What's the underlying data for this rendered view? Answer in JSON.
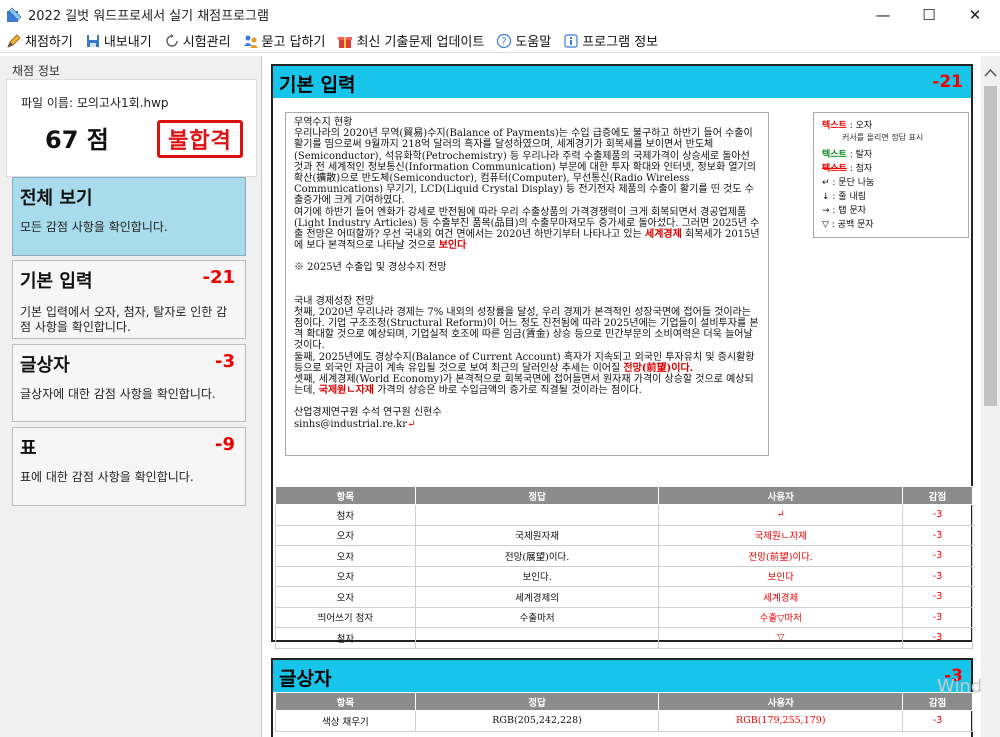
{
  "window": {
    "title": "2022 길벗 워드프로세서 실기 채점프로그램",
    "minimize": "—",
    "maximize": "☐",
    "close": "✕"
  },
  "toolbar": {
    "items": [
      {
        "label": "채점하기",
        "icon": "pencil-icon"
      },
      {
        "label": "내보내기",
        "icon": "save-icon"
      },
      {
        "label": "시험관리",
        "icon": "refresh-icon"
      },
      {
        "label": "묻고 답하기",
        "icon": "people-icon"
      },
      {
        "label": "최신 기출문제 업데이트",
        "icon": "gift-icon"
      },
      {
        "label": "도움말",
        "icon": "help-icon"
      },
      {
        "label": "프로그램 정보",
        "icon": "info-icon"
      }
    ]
  },
  "sidebar": {
    "group_label": "채점 정보",
    "file_label": "파일 이름: 모의고사1회.hwp",
    "score": "67 점",
    "result_stamp": "불합격",
    "cards": [
      {
        "title": "전체 보기",
        "score": "",
        "desc": "모든 감점 사항을 확인합니다."
      },
      {
        "title": "기본 입력",
        "score": "-21",
        "desc": "기본 입력에서 오자, 첨자, 탈자로 인한 감점 사항을 확인합니다."
      },
      {
        "title": "글상자",
        "score": "-3",
        "desc": "글상자에 대한 감점 사항을 확인합니다."
      },
      {
        "title": "표",
        "score": "-9",
        "desc": "표에 대한 감점 사항을 확인합니다."
      }
    ]
  },
  "section1": {
    "title": "기본 입력",
    "score": "-21",
    "doc": {
      "heading": "무역수지 현황",
      "para1": "우리나라의 2020년 무역(貿易)수지(Balance of Payments)는 수입 급증에도 불구하고 하반기 들어 수출이 활기를 띰으로써 9월까지 218억 달러의 흑자를 달성하였으며, 세계경기가 회복세를 보이면서 반도체(Semiconductor), 석유화학(Petrochemistry) 등 우리나라 주력 수출제품의 국제가격이 상승세로 돌아선 것과 전 세계적인 정보통신(Information Communication) 부문에 대한 투자 확대와 인터넷, 정보화 열기의 확산(擴散)으로 반도체(Semiconductor), 컴퓨터(Computer), 무선통신(Radio Wireless Communications) 무기기, LCD(Liquid Crystal Display) 등 전기전자 제품의 수출이 활기를 띤 것도 수출증가에 크게 기여하였다.",
      "para2a": "여기에 하반기 들어 엔화가 강세로 반전됨에 따라 우리 수출상품의 가격경쟁력이 크게 회복되면서 경공업제품(Light Industry Articles) 등 수출부진 품목(品目)의 수출무마져모두 증가세로 돌아섰다. 그러면 2025년 수출 전망은 어떠할까? 우선 국내외 여건 면에서는 2020년 하반기부터 나타나고 있는",
      "para2red1": "세계경제",
      "para2b": "회복세가 2015년에 보다 본격적으로 나타날 것으로",
      "para2red2": "보인다",
      "note": "※ 2025년 수출입 및 경상수지 전망",
      "heading2": "국내 경제성장 전망",
      "para3": "첫째, 2020년 우리나라 경제는 7% 내외의 성장률을 달성, 우리 경제가 본격적인 성장국면에 접어들 것이라는 점이다. 기업 구조조정(Structural Reform)이 어느 정도 진전됨에 따라 2025년에는 기업들이 설비투자를 본격 확대할 것으로 예상되며, 기업실적 호조에 따른 임금(賃金) 상승 등으로 민간부문의 소비여력은 더욱 늘어날 것이다.",
      "para4": "둘째, 2025년에도 경상수지(Balance of Current Account) 흑자가 지속되고 외국인 투자유치 및 증시활황 등으로 외국인 자금이 계속 유입될 것으로 보여 최근의 달러인상 추세는 이어질",
      "para4red": "전망(前望)이다.",
      "para5a": "셋째, 세계경제(World Economy)가 본격적으로 회복국면에 접어들면서 원자재 가격이 상승할 것으로 예상되는데,",
      "para5red": "국제원ㄴ자재",
      "para5b": "가격의 상승은 바로 수입금액의 증가로 직결될 것이라는 점이다.",
      "sign1": "산업경제연구원 수석 연구원 신현수",
      "sign2": "sinhs@industrial.re.kr",
      "enter_mark": "↵"
    },
    "legend": [
      {
        "key": "텍스트",
        "val": ": 오자",
        "color": "#e00",
        "style": "normal"
      },
      {
        "key": "",
        "val": "커서를 올리면 정답 표시",
        "color": "#333",
        "style": "sub"
      },
      {
        "key": "텍스트",
        "val": ": 탈자",
        "color": "#0a8a1a",
        "style": "normal"
      },
      {
        "key": "텍스트",
        "val": ": 첨자",
        "color": "#e00",
        "style": "strike"
      },
      {
        "key": "↵",
        "val": ": 문단 나눔",
        "color": "#111",
        "style": "normal"
      },
      {
        "key": "↓",
        "val": ": 줄 내림",
        "color": "#111",
        "style": "normal"
      },
      {
        "key": "→",
        "val": ": 탭 문자",
        "color": "#111",
        "style": "normal"
      },
      {
        "key": "▽",
        "val": ": 공백 문자",
        "color": "#111",
        "style": "normal"
      }
    ],
    "table": {
      "headers": [
        "항목",
        "정답",
        "사용자",
        "감점"
      ],
      "rows": [
        [
          "첨자",
          "",
          "↵",
          "-3"
        ],
        [
          "오자",
          "국제원자재",
          "국제원ㄴ자재",
          "-3"
        ],
        [
          "오자",
          "전망(展望)이다.",
          "전망(前望)이다.",
          "-3"
        ],
        [
          "오자",
          "보인다.",
          "보인다",
          "-3"
        ],
        [
          "오자",
          "세계경제의",
          "세계경제",
          "-3"
        ],
        [
          "띄어쓰기 첨자",
          "수출마저",
          "수출▽마저",
          "-3"
        ],
        [
          "첨자",
          "",
          "▽",
          "-3"
        ]
      ]
    }
  },
  "section2": {
    "title": "글상자",
    "score": "-3",
    "table": {
      "headers": [
        "항목",
        "정답",
        "사용자",
        "감점"
      ],
      "rows": [
        [
          "색상 채우기",
          "RGB(205,242,228)",
          "RGB(179,255,179)",
          "-3"
        ]
      ]
    }
  },
  "watermark": "Window",
  "colors": {
    "accent": "#18c5ea",
    "card_active": "#a8dcec",
    "error": "#e00"
  }
}
